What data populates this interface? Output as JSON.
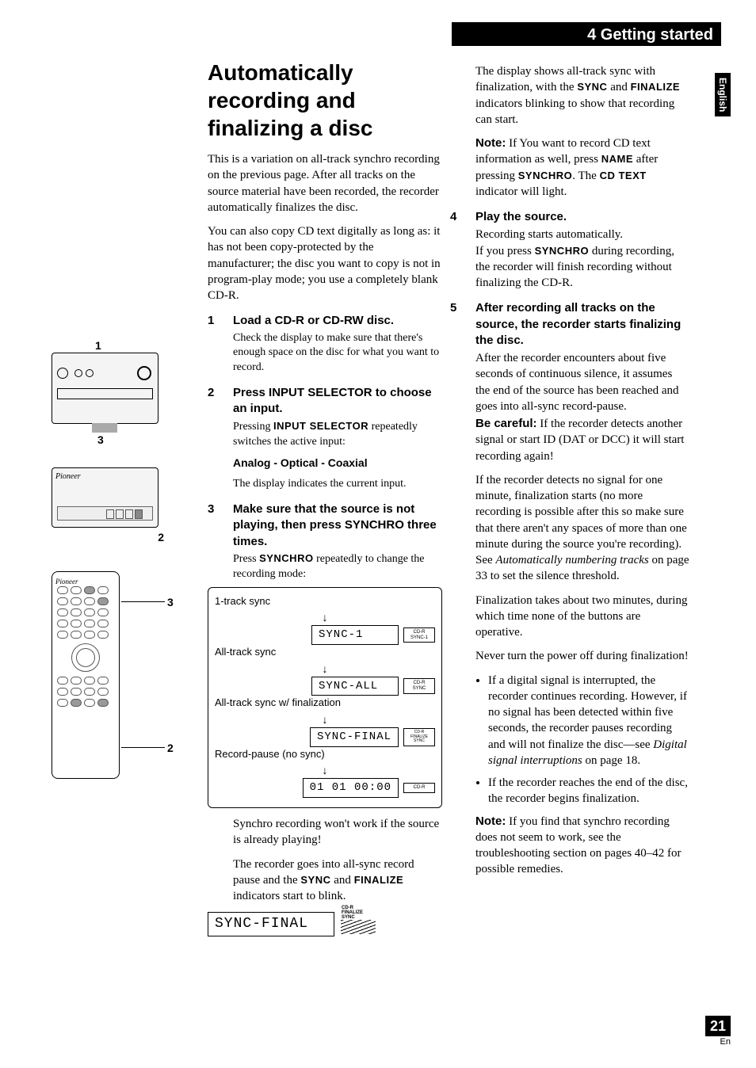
{
  "header": "4 Getting started",
  "language_tab": "English",
  "page_number": "21",
  "page_lang_abbr": "En",
  "figures": {
    "callout1": "1",
    "callout2": "2",
    "callout3": "3"
  },
  "title": "Automatically recording and finalizing a disc",
  "intro1": "This is a variation on all-track synchro recording on the previous page. After all tracks on the source material have been recorded, the recorder automatically finalizes the disc.",
  "intro2": "You can also copy CD text digitally as long as: it has not been copy-protected by the manufacturer; the disc you want to copy is not in program-play mode; you use a completely blank CD-R.",
  "steps": {
    "s1": {
      "num": "1",
      "head": "Load a CD-R or CD-RW disc.",
      "body": "Check the display to make sure that there's enough space on the disc for what you want to record."
    },
    "s2": {
      "num": "2",
      "head": "Press INPUT SELECTOR to choose an input.",
      "body_pre": "Pressing ",
      "body_bold": "INPUT SELECTOR",
      "body_post": " repeatedly switches the active input:",
      "options": "Analog  -  Optical  -    Coaxial",
      "tail": "The display indicates the current input."
    },
    "s3": {
      "num": "3",
      "head": "Make sure that the source is not playing, then press SYNCHRO three times.",
      "body_pre": "Press ",
      "body_bold": "SYNCHRO",
      "body_post": " repeatedly to change the recording mode:"
    },
    "s4": {
      "num": "4",
      "head": "Play the source.",
      "line1": "Recording starts automatically.",
      "line2_pre": "If you press ",
      "line2_bold": "SYNCHRO",
      "line2_post": " during recording, the recorder will finish recording without finalizing the CD-R."
    },
    "s5": {
      "num": "5",
      "head": "After recording all tracks on the source, the recorder starts finalizing the disc.",
      "p1": "After the recorder encounters about five seconds of continuous silence, it assumes the end of the source has been reached and goes into all-sync record-pause.",
      "warn_label": "Be careful:",
      "warn_text": " If the recorder detects another signal or start ID (DAT or DCC) it will start recording again!",
      "p2_pre": "If the recorder detects no signal for one minute, finalization starts (no more recording is possible after this so make sure that there aren't any spaces of more than one minute during the source you're recording). See ",
      "p2_ital": "Automatically numbering tracks",
      "p2_post": " on page 33 to set the silence threshold.",
      "p3": "Finalization takes about two minutes, during which time none of the buttons are operative.",
      "p4": "Never turn the power off during finalization!"
    }
  },
  "mode_cycle": {
    "m1": {
      "label": "1-track sync",
      "disp": "SYNC-1",
      "ind": "CD-R\nSYNC-1"
    },
    "m2": {
      "label": "All-track sync",
      "disp": "SYNC-ALL",
      "ind": "CD-R\nSYNC"
    },
    "m3": {
      "label": "All-track sync w/ finalization",
      "disp": "SYNC-FINAL",
      "ind": "CD-R\nFINALIZE\nSYNC"
    },
    "m4": {
      "label": "Record-pause (no sync)",
      "disp": "01 01 00:00",
      "ind": "CD-R"
    }
  },
  "after_cycle": {
    "p1": "Synchro recording won't work if the source is already playing!",
    "p2_pre": "The recorder goes into all-sync record pause and the ",
    "p2_b1": "SYNC",
    "p2_mid": " and ",
    "p2_b2": "FINALIZE",
    "p2_post": " indicators start to blink."
  },
  "bottom_display": "SYNC-FINAL",
  "bottom_indicator": "CD-R\nFINALIZE\nSYNC",
  "right": {
    "p0_pre": "The display shows all-track sync with finalization, with the ",
    "p0_b1": "SYNC",
    "p0_mid": " and ",
    "p0_b2": "FINALIZE",
    "p0_post": " indicators blinking to show that recording can start.",
    "note_label": "Note:",
    "note1_pre": " If You want to record CD text information as well, press ",
    "note1_b1": "NAME",
    "note1_mid": " after pressing ",
    "note1_b2": "SYNCHRO",
    "note1_post": ". The ",
    "note1_b3": "CD TEXT",
    "note1_tail": " indicator will light.",
    "bul1_pre": "If a digital signal is interrupted, the recorder continues recording. However, if no signal has been detected within five seconds, the recorder pauses recording and will not finalize the disc—see ",
    "bul1_ital": "Digital signal interruptions",
    "bul1_post": " on page 18.",
    "bul2": "If the recorder reaches the end of the disc, the recorder begins finalization.",
    "note2": " If you find that synchro recording does not seem to work, see the troubleshooting section on pages 40–42 for possible remedies."
  }
}
